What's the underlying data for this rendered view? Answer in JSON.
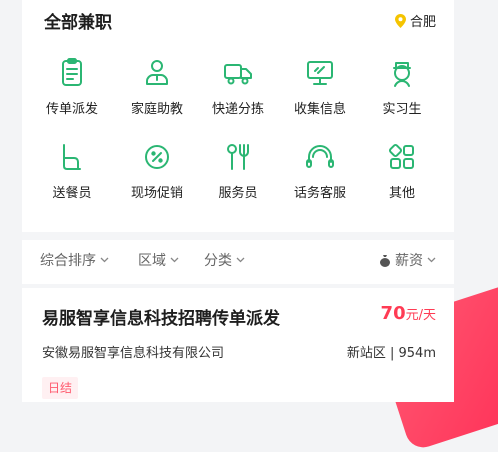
{
  "header": {
    "title": "全部兼职",
    "city": "合肥"
  },
  "categories": [
    {
      "label": "传单派发",
      "icon": "clipboard-icon"
    },
    {
      "label": "家庭助教",
      "icon": "tutor-icon"
    },
    {
      "label": "快递分拣",
      "icon": "delivery-truck-icon"
    },
    {
      "label": "收集信息",
      "icon": "monitor-icon"
    },
    {
      "label": "实习生",
      "icon": "intern-icon"
    },
    {
      "label": "送餐员",
      "icon": "food-delivery-icon"
    },
    {
      "label": "现场促销",
      "icon": "discount-icon"
    },
    {
      "label": "服务员",
      "icon": "utensils-icon"
    },
    {
      "label": "话务客服",
      "icon": "headset-icon"
    },
    {
      "label": "其他",
      "icon": "grid-icon"
    }
  ],
  "filters": {
    "sort": "综合排序",
    "area": "区域",
    "category": "分类",
    "salary": "薪资"
  },
  "job": {
    "title": "易服智享信息科技招聘传单派发",
    "salary_amount": "70",
    "salary_unit": "元/天",
    "company": "安徽易服智享信息科技有限公司",
    "location": "新站区 | 954m",
    "tag": "日结"
  },
  "colors": {
    "accent": "#2bb673",
    "price": "#ff3b54",
    "pin": "#f5c400"
  }
}
